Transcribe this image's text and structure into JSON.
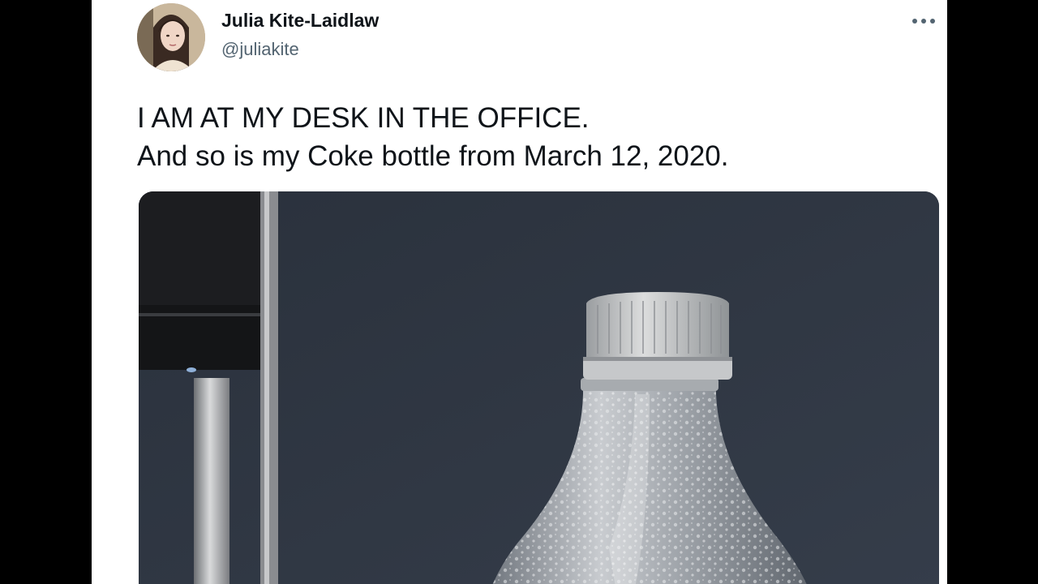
{
  "tweet": {
    "author": {
      "display_name": "Julia Kite-Laidlaw",
      "handle": "@juliakite"
    },
    "text_lines": [
      "I AM AT MY DESK IN THE OFFICE.",
      "And so is my Coke bottle from March 12, 2020."
    ],
    "media": {
      "kind": "photo"
    },
    "icons": {
      "more": "more-horizontal-icon"
    }
  },
  "colors": {
    "card_background": "#ffffff",
    "page_background": "#000000",
    "primary_text": "#0f1419",
    "secondary_text": "#536471"
  }
}
